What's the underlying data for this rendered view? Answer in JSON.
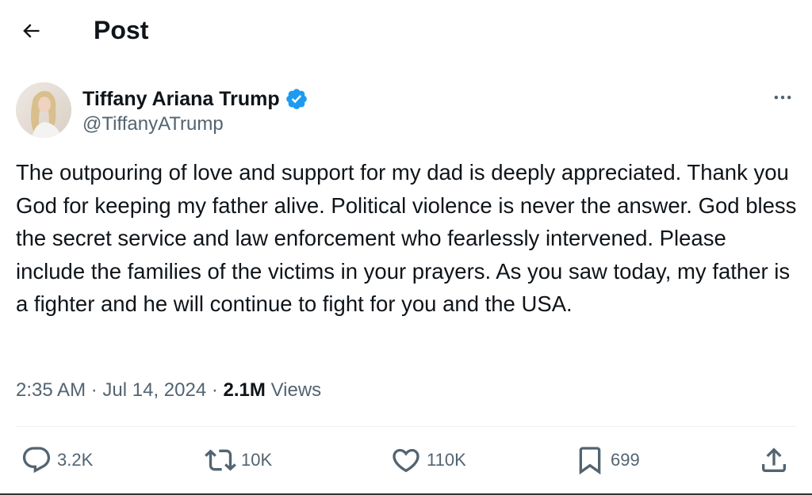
{
  "header": {
    "title": "Post",
    "back_icon": "arrow-left-icon"
  },
  "author": {
    "name": "Tiffany Ariana Trump",
    "handle": "@TiffanyATrump",
    "verified_icon": "verified-badge-icon",
    "verified_color": "#1d9bf0",
    "more_icon": "more-horizontal-icon"
  },
  "post": {
    "text": "The outpouring of love and support for my dad is deeply appreciated. Thank you God for keeping my father alive. Political violence is never the answer. God bless the secret service and law enforcement who fearlessly intervened. Please include the families of the victims in your prayers. As you saw today, my father is a fighter and he will continue to fight for you and the USA.",
    "time": "2:35 AM",
    "date": "Jul 14, 2024",
    "views_count": "2.1M",
    "views_label": "Views"
  },
  "actions": {
    "reply_count": "3.2K",
    "repost_count": "10K",
    "like_count": "110K",
    "bookmark_count": "699",
    "reply_icon": "reply-bubble-icon",
    "repost_icon": "repost-arrows-icon",
    "like_icon": "heart-icon",
    "bookmark_icon": "bookmark-icon",
    "share_icon": "share-upload-icon"
  },
  "colors": {
    "text_primary": "#0f1419",
    "text_secondary": "#536471",
    "accent": "#1d9bf0",
    "divider": "#eff3f4"
  }
}
